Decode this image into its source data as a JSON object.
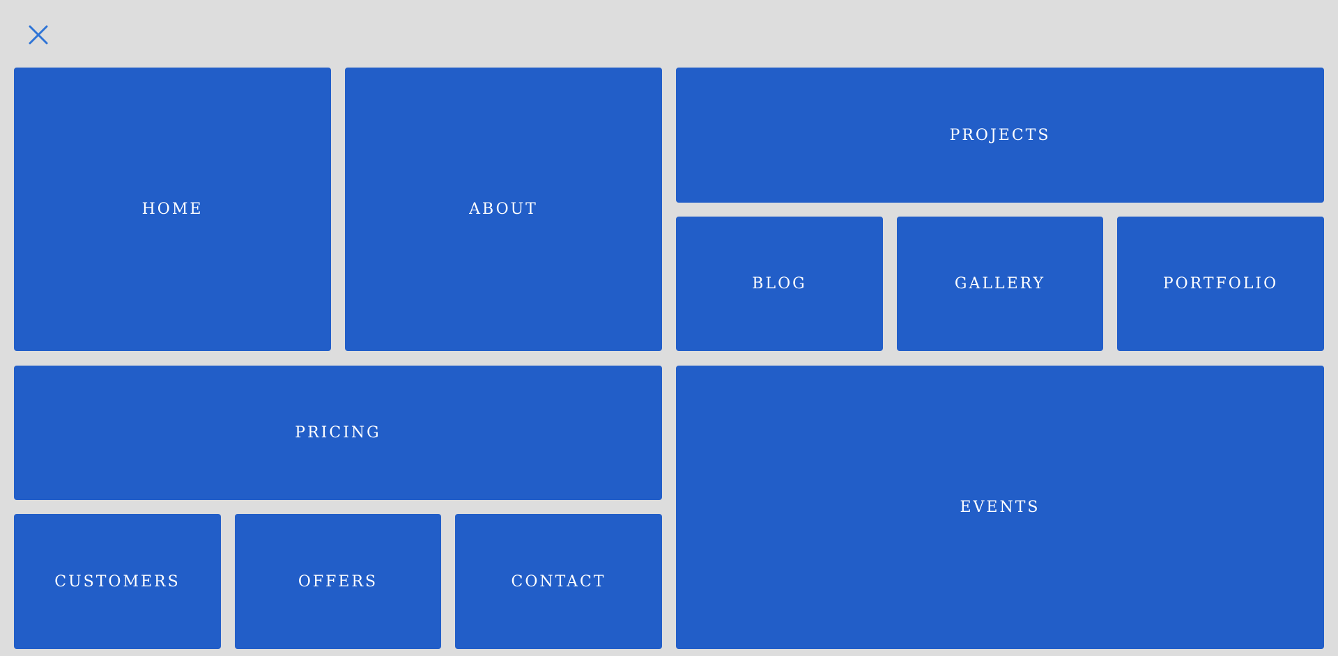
{
  "close_button": {
    "icon": "close-icon",
    "color": "#2f74d6"
  },
  "menu": {
    "tile_color": "#225ec8",
    "text_color": "#ffffff",
    "background": "#dddddd",
    "items": {
      "home": "HOME",
      "about": "ABOUT",
      "projects": "PROJECTS",
      "blog": "BLOG",
      "gallery": "GALLERY",
      "portfolio": "PORTFOLIO",
      "pricing": "PRICING",
      "events": "EVENTS",
      "customers": "CUSTOMERS",
      "offers": "OFFERS",
      "contact": "CONTACT"
    }
  }
}
